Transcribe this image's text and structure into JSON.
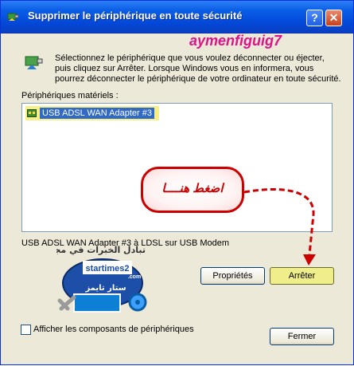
{
  "window": {
    "title": "Supprimer le périphérique en toute sécurité",
    "help_glyph": "?",
    "close_glyph": "✕"
  },
  "watermark_brand": "aymenfiguig7",
  "intro_text": "Sélectionnez le périphérique que vous voulez déconnecter ou éjecter, puis cliquez sur Arrêter. Lorsque Windows vous en informera, vous pourrez déconnecter le périphérique de votre ordinateur en toute sécurité.",
  "hardware_list": {
    "label": "Périphériques matériels :",
    "items": [
      "USB ADSL WAN Adapter #3"
    ]
  },
  "callout_text": "اضغط هنــــا",
  "device_info": "USB ADSL WAN Adapter #3 à LDSL sur USB Modem",
  "logo": {
    "arabic_slogan": "تبادل الخبرات في مجال الحاسب",
    "site": "startimes2",
    "tld": ".com",
    "sub": "ستار تايمز"
  },
  "buttons": {
    "properties": "Propriétés",
    "stop": "Arrêter",
    "close": "Fermer"
  },
  "show_components_label": "Afficher les composants de périphériques",
  "colors": {
    "accent": "#0a5ee6",
    "annotation_red": "#cc0000",
    "brand_pink": "#e0128a",
    "highlight_yellow": "#f7ef87"
  }
}
